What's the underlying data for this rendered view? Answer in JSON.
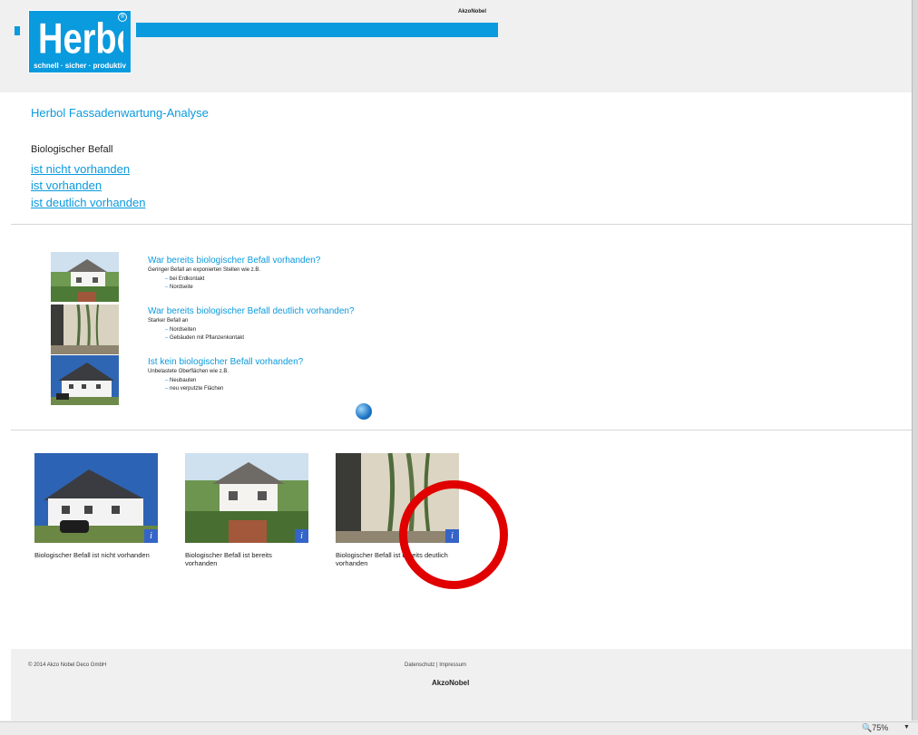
{
  "header": {
    "logo_text": "Herbol",
    "logo_reg": "®",
    "logo_tagline": "schnell · sicher · produktiv",
    "brand_top": "AkzoNobel"
  },
  "page_title": "Herbol Fassadenwartung-Analyse",
  "section": {
    "label": "Biologischer Befall",
    "options": [
      "ist nicht vorhanden",
      "ist vorhanden",
      "ist deutlich vorhanden"
    ]
  },
  "questions": [
    {
      "title": "War bereits biologischer Befall vorhanden?",
      "subtitle": "Geringer Befall an exponierten Stellen wie z.B.",
      "bullets": [
        "bei Erdkontakt",
        "Nordseite"
      ]
    },
    {
      "title": "War bereits biologischer Befall deutlich vorhanden?",
      "subtitle": "Starker Befall an",
      "bullets": [
        "Nordseiten",
        "Gebäuden mit Pflanzenkontakt"
      ]
    },
    {
      "title": "Ist kein biologischer Befall vorhanden?",
      "subtitle": "Unbelastete Oberflächen wie z.B.",
      "bullets": [
        "Neubauten",
        "neu verputzte Flächen"
      ]
    }
  ],
  "cards": [
    {
      "caption": "Biologischer Befall ist nicht vorhanden",
      "info": "i"
    },
    {
      "caption": "Biologischer Befall ist bereits vorhanden",
      "info": "i"
    },
    {
      "caption": "Biologischer Befall ist bereits deutlich vorhanden",
      "info": "i"
    }
  ],
  "footer": {
    "copyright": "© 2014 Akzo Nobel Deco GmbH",
    "link_privacy": "Datenschutz",
    "link_separator": "|",
    "link_imprint": "Impressum",
    "brand": "AkzoNobel"
  },
  "statusbar": {
    "zoom": "75%"
  },
  "colors": {
    "accent": "#0a9ade",
    "info_badge": "#3564c8",
    "annotation": "#e00000"
  }
}
